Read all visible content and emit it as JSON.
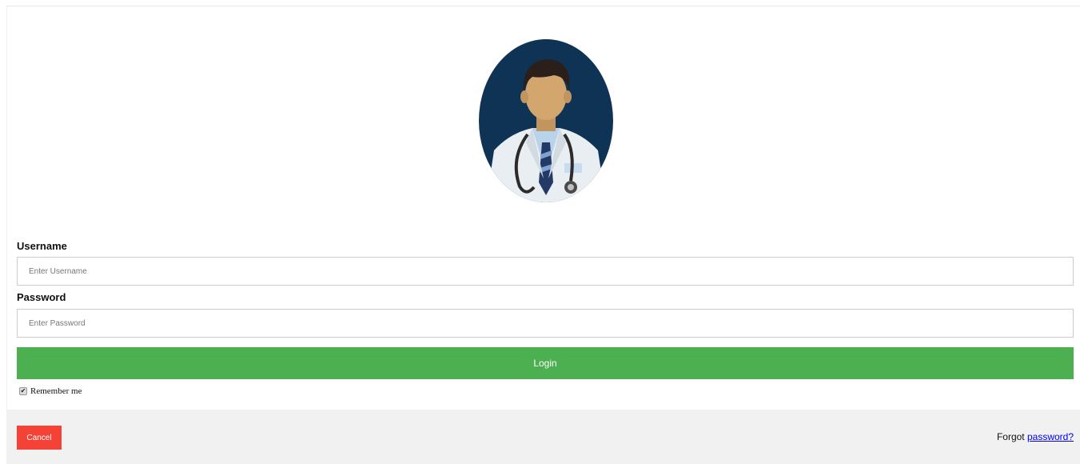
{
  "form": {
    "username_label": "Username",
    "username_placeholder": "Enter Username",
    "username_value": "",
    "password_label": "Password",
    "password_placeholder": "Enter Password",
    "password_value": "",
    "login_label": "Login",
    "remember_label": "Remember me",
    "remember_checked": true
  },
  "footer": {
    "cancel_label": "Cancel",
    "forgot_prefix": "Forgot",
    "forgot_link": "password?"
  },
  "avatar": {
    "icon": "doctor-avatar-icon"
  },
  "colors": {
    "login_button": "#4caf50",
    "cancel_button": "#f44336",
    "footer_background": "#f1f1f1",
    "avatar_background": "#0f3355",
    "link": "#0000ee"
  }
}
